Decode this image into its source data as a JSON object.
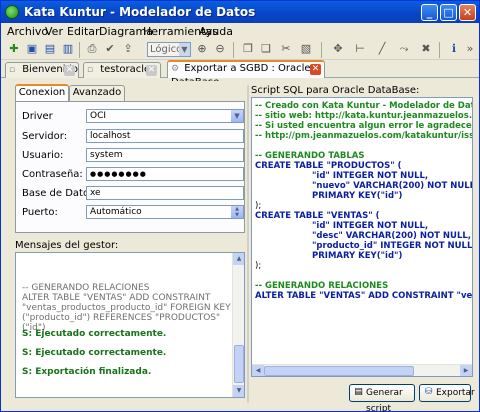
{
  "window": {
    "title": "Kata Kuntur - Modelador de Datos",
    "controls": {
      "minimize": "_",
      "maximize": "□",
      "close": "✕"
    }
  },
  "menu": [
    "Archivo",
    "Ver",
    "Editar",
    "Diagrama",
    "Herramientas",
    "Ayuda"
  ],
  "toolbar": {
    "zoom_combo": "Lógico"
  },
  "doc_tabs": [
    {
      "label": "Bienvenido",
      "active": false
    },
    {
      "label": "testoracle",
      "active": false
    },
    {
      "label": "Exportar a SGBD : Oracle DataBase",
      "active": true
    }
  ],
  "connection": {
    "tabs": [
      "Conexion",
      "Avanzado"
    ],
    "fields": {
      "driver": {
        "label": "Driver",
        "value": "OCI"
      },
      "server": {
        "label": "Servidor:",
        "value": "localhost"
      },
      "user": {
        "label": "Usuario:",
        "value": "system"
      },
      "password": {
        "label": "Contraseña:",
        "value": "●●●●●●●●"
      },
      "database": {
        "label": "Base de Datos:",
        "value": "xe"
      },
      "port": {
        "label": "Puerto:",
        "value": "Automático"
      }
    }
  },
  "messages": {
    "label": "Mensajes del gestor:",
    "log": "-- GENERANDO RELACIONES\nALTER TABLE \"VENTAS\" ADD CONSTRAINT \"ventas_productos_producto_id\" FOREIGN KEY (\"producto_id\") REFERENCES \"PRODUCTOS\"(\"id\")",
    "status": [
      "S: Ejecutado correctamente.",
      "S: Ejecutado correctamente.",
      "S: Exportación finalizada."
    ]
  },
  "sql": {
    "label": "Script SQL para Oracle DataBase:",
    "lines": [
      "-- Creado con Kata Kuntur - Modelador de Datos",
      "-- sitio web: http://kata.kuntur.jeanmazuelos.com/",
      "-- Si usted encuentra algun error le agradeceriamos lo",
      "-- http://pm.jeanmazuelos.com/katakuntur/issues/ne",
      "-- GENERANDO TABLAS",
      "CREATE TABLE \"PRODUCTOS\" (",
      "\"id\" INTEGER NOT NULL,",
      "\"nuevo\" VARCHAR(200) NOT NULL,",
      "PRIMARY KEY(\"id\")",
      ");",
      "CREATE TABLE \"VENTAS\" (",
      "\"id\" INTEGER NOT NULL,",
      "\"desc\" VARCHAR(200) NOT NULL,",
      "\"producto_id\" INTEGER NOT NULL,",
      "PRIMARY KEY(\"id\")",
      ");",
      "-- GENERANDO RELACIONES",
      "ALTER TABLE \"VENTAS\" ADD CONSTRAINT \"ventas_producto"
    ]
  },
  "actions": {
    "generate": "Generar script",
    "export": "Exportar"
  }
}
